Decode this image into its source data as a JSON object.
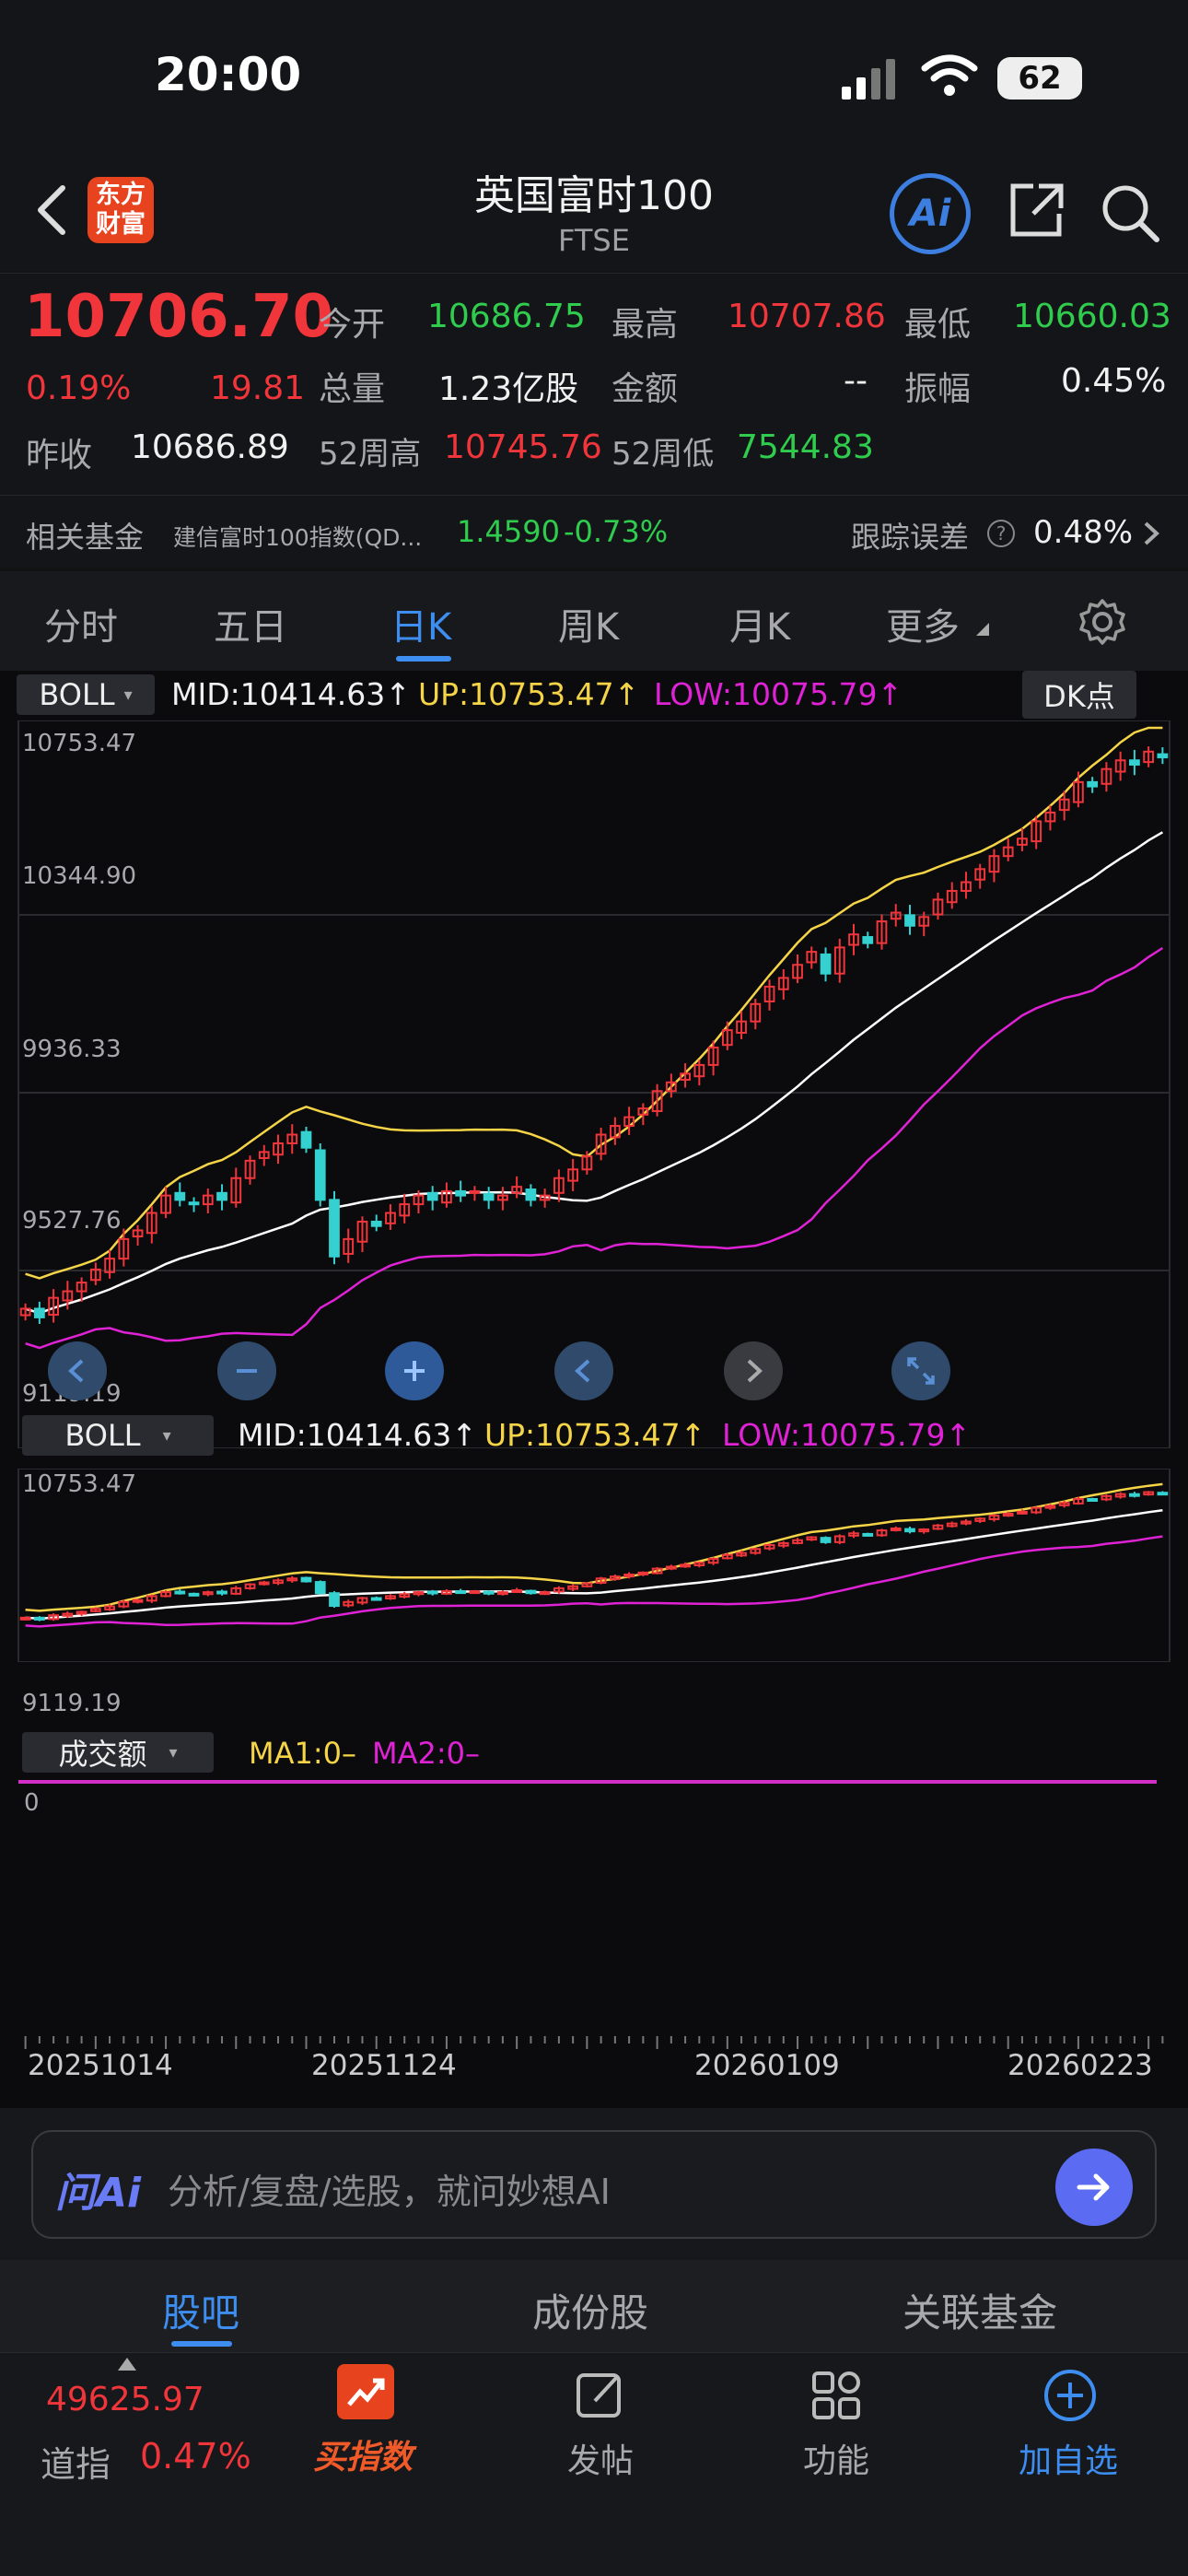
{
  "status": {
    "time": "20:00",
    "battery": "62"
  },
  "header": {
    "app_logo_line1": "东方",
    "app_logo_line2": "财富",
    "title": "英国富时100",
    "subtitle": "FTSE",
    "ai_label": "Ai"
  },
  "quote": {
    "price": "10706.70",
    "change_pct": "0.19%",
    "change": "19.81",
    "open_label": "今开",
    "open": "10686.75",
    "high_label": "最高",
    "high": "10707.86",
    "low_label": "最低",
    "low": "10660.03",
    "volume_label": "总量",
    "volume": "1.23亿股",
    "amount_label": "金额",
    "amount": "--",
    "amplitude_label": "振幅",
    "amplitude": "0.45%",
    "prev_close_label": "昨收",
    "prev_close": "10686.89",
    "week52_high_label": "52周高",
    "week52_high": "10745.76",
    "week52_low_label": "52周低",
    "week52_low": "7544.83"
  },
  "fund": {
    "label": "相关基金",
    "name": "建信富时100指数(QD...",
    "nav": "1.4590",
    "change": "-0.73%",
    "track_label": "跟踪误差",
    "track_value": "0.48%"
  },
  "tabs": [
    "分时",
    "五日",
    "日K",
    "周K",
    "月K",
    "更多"
  ],
  "active_tab": "日K",
  "main_chart": {
    "indicator": "BOLL",
    "mid": "MID:10414.63",
    "up": "UP:10753.47",
    "low": "LOW:10075.79",
    "dk_button": "DK点",
    "y_labels": [
      "10753.47",
      "10344.90",
      "9936.33",
      "9527.76",
      "9119.19"
    ]
  },
  "mini_chart": {
    "indicator": "BOLL",
    "mid": "MID:10414.63",
    "up": "UP:10753.47",
    "low": "LOW:10075.79",
    "y_top": "10753.47",
    "y_bottom": "9119.19"
  },
  "volume_chart": {
    "indicator": "成交额",
    "ma1": "MA1:0–",
    "ma2": "MA2:0–",
    "y0": "0"
  },
  "x_dates": [
    "20251014",
    "20251124",
    "20260109",
    "20260223"
  ],
  "ask": {
    "brand": "问Ai",
    "placeholder": "分析/复盘/选股，就问妙想AI"
  },
  "subtabs": [
    "股吧",
    "成份股",
    "关联基金"
  ],
  "bottom": {
    "index_value": "49625.97",
    "index_name": "道指",
    "index_change": "0.47%",
    "buy_index": "买指数",
    "post": "发帖",
    "func": "功能",
    "add_watch": "加自选"
  },
  "colors": {
    "red": "#f0353b",
    "green": "#2fcc4e",
    "up_line": "#f5d547",
    "low_line": "#e022d6",
    "mid_line": "#ffffff",
    "accent": "#3d8ef0"
  },
  "chart_data": {
    "type": "candlestick",
    "x_start": "20251014",
    "x_end": "20260223",
    "ylim": [
      9119.19,
      10753.47
    ],
    "indicator_lines": [
      "MID",
      "UP",
      "LOW"
    ],
    "close": [
      9440,
      9420,
      9465,
      9480,
      9500,
      9530,
      9555,
      9600,
      9620,
      9660,
      9700,
      9690,
      9680,
      9700,
      9690,
      9740,
      9780,
      9800,
      9820,
      9840,
      9810,
      9690,
      9560,
      9600,
      9640,
      9630,
      9660,
      9680,
      9700,
      9690,
      9710,
      9700,
      9710,
      9690,
      9700,
      9720,
      9690,
      9700,
      9740,
      9760,
      9790,
      9840,
      9860,
      9880,
      9900,
      9940,
      9960,
      9980,
      10000,
      10040,
      10080,
      10100,
      10140,
      10180,
      10200,
      10230,
      10260,
      10210,
      10270,
      10300,
      10280,
      10330,
      10350,
      10320,
      10340,
      10380,
      10400,
      10420,
      10450,
      10480,
      10500,
      10520,
      10560,
      10580,
      10610,
      10650,
      10640,
      10680,
      10700,
      10690,
      10720,
      10706.7
    ]
  }
}
